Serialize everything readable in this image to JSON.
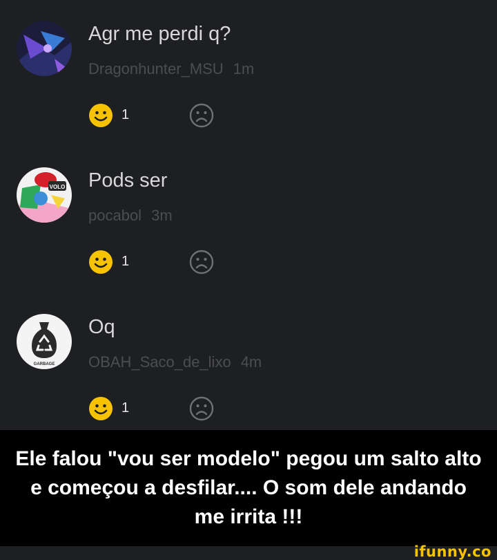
{
  "comments": [
    {
      "text": "Agr me perdi q?",
      "username": "Dragonhunter_MSU",
      "time": "1m",
      "likes": "1"
    },
    {
      "text": "Pods ser",
      "username": "pocabol",
      "time": "3m",
      "likes": "1"
    },
    {
      "text": "Oq",
      "username": "OBAH_Saco_de_lixo",
      "time": "4m",
      "likes": "1"
    }
  ],
  "avatar_badge_text": "GARBAGE",
  "avatar_logo_text": "VOLO",
  "caption": "Ele falou \"vou ser modelo\" pegou um salto alto e começou a desfilar.... O som dele andando me irrita !!!",
  "watermark": "ifunny.co",
  "colors": {
    "accent": "#f7c200",
    "background": "#1e1f22",
    "meta": "#4b4d52"
  },
  "icons": [
    "smile-reaction-icon",
    "frown-reaction-icon",
    "recycle-bag-icon"
  ]
}
